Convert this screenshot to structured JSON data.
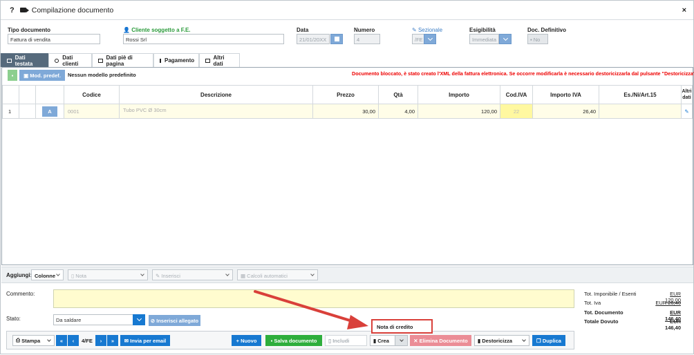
{
  "title": "Compilazione documento",
  "header": {
    "tipo_label": "Tipo documento",
    "tipo_value": "Fattura di vendita",
    "cliente_label": "Cliente soggetto a F.E.",
    "cliente_value": "Rossi Srl",
    "data_label": "Data",
    "data_value": "21/01/20XX",
    "numero_label": "Numero",
    "numero_value": "4",
    "sezionale_label": "Sezionale",
    "sezionale_value": "/FE",
    "esigibilita_label": "Esigibilità",
    "esigibilita_value": "Immediata",
    "docdef_label": "Doc. Definitivo",
    "docdef_value": "No"
  },
  "tabs": [
    "Dati testata",
    "Dati clienti",
    "Dati piè di pagina",
    "Pagamento",
    "Altri dati"
  ],
  "toolbar": {
    "mod_label": "Mod. predef.",
    "modello_text": "Nessun modello predefinito",
    "warning": "Documento bloccato, è stato creato l'XML della fattura elettronica. Se occorre modificarla è necessario destoricizzarla dal pulsante \"Destoricizza\""
  },
  "columns": [
    "Codice",
    "Descrizione",
    "Prezzo",
    "Qtà",
    "Importo",
    "Cod.IVA",
    "Importo IVA",
    "Es./Ni/Art.15",
    "Altri"
  ],
  "columns_extra": "dati",
  "rows": [
    {
      "n": "1",
      "btn": "A",
      "codice": "0001",
      "descrizione": "Tubo PVC Ø 30cm",
      "prezzo": "30,00",
      "qta": "4,00",
      "importo": "120,00",
      "codiva": "22",
      "importoiva": "26,40"
    }
  ],
  "aggiungi": {
    "label": "Aggiungi:",
    "colonne": "Colonne",
    "nota": "Nota",
    "inserisci": "Inserisci",
    "calcoli": "Calcoli automatici"
  },
  "commento_label": "Commento:",
  "stato": {
    "label": "Stato:",
    "value": "Da saldare",
    "allegato": "Inserisci allegato"
  },
  "totals": [
    {
      "label": "Tot. Imponibile / Esenti",
      "value": "EUR 120,00",
      "bold": false
    },
    {
      "label": "Tot. Iva",
      "value": "EUR 26,40",
      "bold": false
    },
    {
      "label": "Tot. Documento",
      "value": "EUR 146,40",
      "bold": true
    },
    {
      "label": "Totale Dovuto",
      "value": "EUR 146,40",
      "bold": true
    }
  ],
  "dropdown_item": "Nota di credito",
  "bottom": {
    "stampa": "Stampa",
    "pag": "4/FE",
    "email": "Invia per email",
    "nuovo": "Nuovo",
    "salva": "Salva documento",
    "includi": "Includi",
    "crea": "Crea",
    "elimina": "Elimina Documento",
    "destoricizza": "Destoricizza",
    "duplica": "Duplica"
  }
}
